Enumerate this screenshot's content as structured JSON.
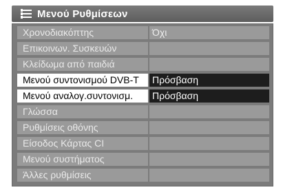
{
  "title": "Μενού Ρυθμίσεων",
  "items": [
    {
      "label": "Χρονοδιακόπτης",
      "value": "Όχι",
      "active": false
    },
    {
      "label": "Επικοινων. Συσκευών",
      "value": "",
      "active": false
    },
    {
      "label": "Κλείδωμα από παιδιά",
      "value": "",
      "active": false
    },
    {
      "label": "Μενού συντονισμού DVB-T",
      "value": "Πρόσβαση",
      "active": true
    },
    {
      "label": "Μενού αναλογ.συντονισμ.",
      "value": "Πρόσβαση",
      "active": true
    },
    {
      "label": "Γλώσσα",
      "value": "",
      "active": false
    },
    {
      "label": "Ρυθμίσεις οθόνης",
      "value": "",
      "active": false
    },
    {
      "label": "Είσοδος Κάρτας CI",
      "value": "",
      "active": false
    },
    {
      "label": "Μενού συστήματος",
      "value": "",
      "active": false
    },
    {
      "label": "Άλλες ρυθμίσεις",
      "value": "",
      "active": false
    }
  ],
  "icons": {
    "title": "list-menu-icon"
  },
  "colors": {
    "title_bg": "#666666",
    "list_bg": "#7b7b7b",
    "row_bg": "#9a9a9a",
    "active_label_bg": "#ffffff",
    "active_value_bg": "#1d1d1d"
  }
}
